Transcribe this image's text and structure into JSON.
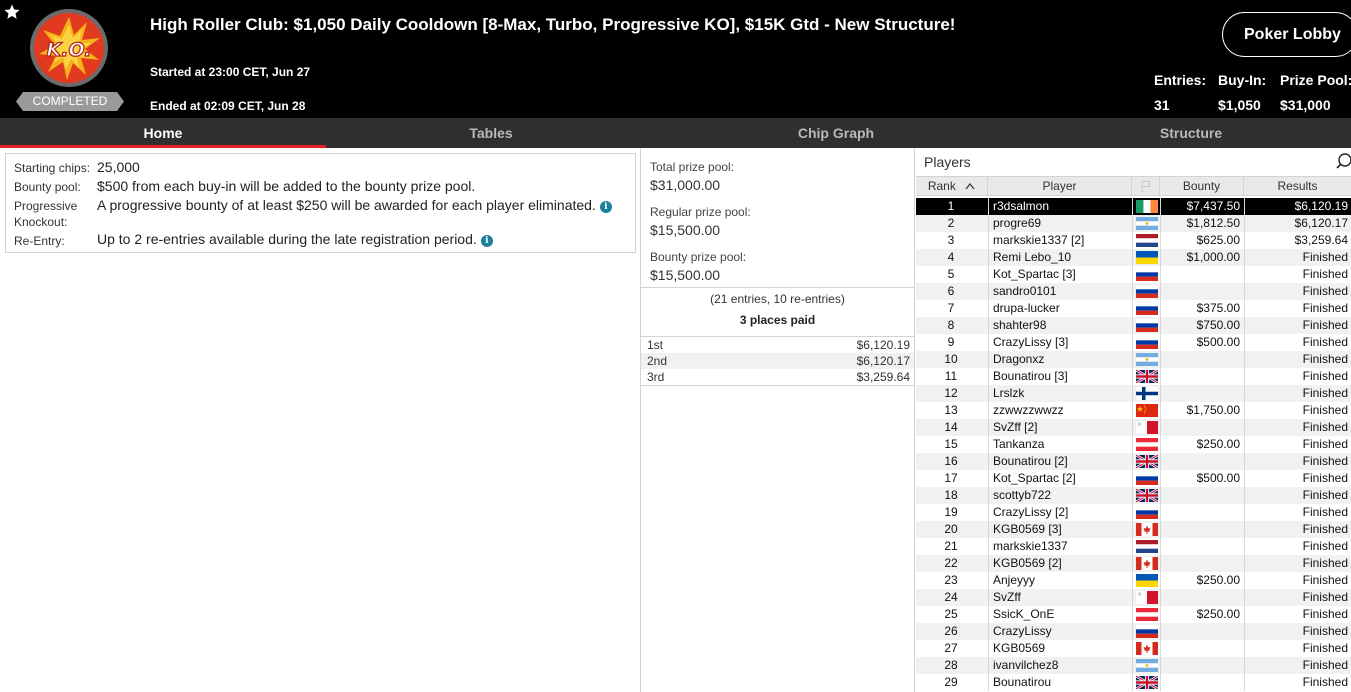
{
  "header": {
    "title": "High Roller Club: $1,050 Daily Cooldown [8-Max, Turbo, Progressive KO], $15K Gtd - New Structure!",
    "logo_text": "K.O.",
    "status_badge": "COMPLETED",
    "started": "Started at 23:00 CET, Jun 27",
    "ended": "Ended at 02:09 CET, Jun 28",
    "lobby_button": "Poker Lobby",
    "stats": {
      "entries_label": "Entries:",
      "entries_value": "31",
      "buyin_label": "Buy-In:",
      "buyin_value": "$1,050",
      "prizepool_label": "Prize Pool:",
      "prizepool_value": "$31,000"
    }
  },
  "tabs": [
    {
      "label": "Home",
      "active": true
    },
    {
      "label": "Tables",
      "active": false
    },
    {
      "label": "Chip Graph",
      "active": false
    },
    {
      "label": "Structure",
      "active": false
    }
  ],
  "info": {
    "starting_chips_label": "Starting chips:",
    "starting_chips_value": "25,000",
    "bounty_pool_label": "Bounty pool:",
    "bounty_pool_value": "$500 from each buy-in will be added to the bounty prize pool.",
    "pko_label_1": "Progressive",
    "pko_label_2": "Knockout:",
    "pko_value": "A progressive bounty of at least $250 will be awarded for each player eliminated.",
    "reentry_label": "Re-Entry:",
    "reentry_value": "Up to 2 re-entries available during the late registration period.",
    "info_glyph": "i"
  },
  "prize_pool": {
    "total_label": "Total prize pool:",
    "total_value": "$31,000.00",
    "regular_label": "Regular prize pool:",
    "regular_value": "$15,500.00",
    "bounty_label": "Bounty prize pool:",
    "bounty_value": "$15,500.00",
    "entries_note": "(21 entries, 10 re-entries)",
    "places_paid": "3 places paid",
    "payouts": [
      {
        "place": "1st",
        "amount": "$6,120.19"
      },
      {
        "place": "2nd",
        "amount": "$6,120.17"
      },
      {
        "place": "3rd",
        "amount": "$3,259.64"
      }
    ]
  },
  "players": {
    "title": "Players",
    "columns": {
      "rank": "Rank",
      "player": "Player",
      "bounty": "Bounty",
      "results": "Results"
    },
    "sort_indicator": "^",
    "selected_rank": 1,
    "rows": [
      {
        "rank": "1",
        "player": "r3dsalmon",
        "flag": "ie",
        "bounty": "$7,437.50",
        "result": "$6,120.19"
      },
      {
        "rank": "2",
        "player": "progre69",
        "flag": "ar",
        "bounty": "$1,812.50",
        "result": "$6,120.17"
      },
      {
        "rank": "3",
        "player": "markskie1337 [2]",
        "flag": "nl",
        "bounty": "$625.00",
        "result": "$3,259.64"
      },
      {
        "rank": "4",
        "player": "Remi Lebo_10",
        "flag": "ua",
        "bounty": "$1,000.00",
        "result": "Finished"
      },
      {
        "rank": "5",
        "player": "Kot_Spartac [3]",
        "flag": "ru",
        "bounty": "",
        "result": "Finished"
      },
      {
        "rank": "6",
        "player": "sandro0101",
        "flag": "ru",
        "bounty": "",
        "result": "Finished"
      },
      {
        "rank": "7",
        "player": "drupa-lucker",
        "flag": "ru",
        "bounty": "$375.00",
        "result": "Finished"
      },
      {
        "rank": "8",
        "player": "shahter98",
        "flag": "ru",
        "bounty": "$750.00",
        "result": "Finished"
      },
      {
        "rank": "9",
        "player": "CrazyLissy [3]",
        "flag": "ru",
        "bounty": "$500.00",
        "result": "Finished"
      },
      {
        "rank": "10",
        "player": "Dragonxz",
        "flag": "ar",
        "bounty": "",
        "result": "Finished"
      },
      {
        "rank": "11",
        "player": "Bounatirou [3]",
        "flag": "gb",
        "bounty": "",
        "result": "Finished"
      },
      {
        "rank": "12",
        "player": "Lrslzk",
        "flag": "fi",
        "bounty": "",
        "result": "Finished"
      },
      {
        "rank": "13",
        "player": "zzwwzzwwzz",
        "flag": "cn",
        "bounty": "$1,750.00",
        "result": "Finished"
      },
      {
        "rank": "14",
        "player": "SvZff [2]",
        "flag": "mt",
        "bounty": "",
        "result": "Finished"
      },
      {
        "rank": "15",
        "player": "Tankanza",
        "flag": "at",
        "bounty": "$250.00",
        "result": "Finished"
      },
      {
        "rank": "16",
        "player": "Bounatirou [2]",
        "flag": "gb",
        "bounty": "",
        "result": "Finished"
      },
      {
        "rank": "17",
        "player": "Kot_Spartac [2]",
        "flag": "ru",
        "bounty": "$500.00",
        "result": "Finished"
      },
      {
        "rank": "18",
        "player": "scottyb722",
        "flag": "gb",
        "bounty": "",
        "result": "Finished"
      },
      {
        "rank": "19",
        "player": "CrazyLissy [2]",
        "flag": "ru",
        "bounty": "",
        "result": "Finished"
      },
      {
        "rank": "20",
        "player": "KGB0569 [3]",
        "flag": "ca",
        "bounty": "",
        "result": "Finished"
      },
      {
        "rank": "21",
        "player": "markskie1337",
        "flag": "nl",
        "bounty": "",
        "result": "Finished"
      },
      {
        "rank": "22",
        "player": "KGB0569 [2]",
        "flag": "ca",
        "bounty": "",
        "result": "Finished"
      },
      {
        "rank": "23",
        "player": "Anjeyyy",
        "flag": "ua",
        "bounty": "$250.00",
        "result": "Finished"
      },
      {
        "rank": "24",
        "player": "SvZff",
        "flag": "mt",
        "bounty": "",
        "result": "Finished"
      },
      {
        "rank": "25",
        "player": "SsicK_OnE",
        "flag": "at",
        "bounty": "$250.00",
        "result": "Finished"
      },
      {
        "rank": "26",
        "player": "CrazyLissy",
        "flag": "ru",
        "bounty": "",
        "result": "Finished"
      },
      {
        "rank": "27",
        "player": "KGB0569",
        "flag": "ca",
        "bounty": "",
        "result": "Finished"
      },
      {
        "rank": "28",
        "player": "ivanvilchez8",
        "flag": "ar",
        "bounty": "",
        "result": "Finished"
      },
      {
        "rank": "29",
        "player": "Bounatirou",
        "flag": "gb",
        "bounty": "",
        "result": "Finished"
      }
    ]
  },
  "colors": {
    "header_bg": "#000000",
    "tabbar_bg": "#2f2f2f",
    "active_tab_underline": "#e31e25",
    "badge_bg": "#9a9a9a",
    "info_icon": "#1b7f9e",
    "selected_row_bg": "#000000"
  },
  "icons": {
    "star": "star-icon",
    "search": "search-icon",
    "sort": "sort-up-icon",
    "flag_column": "flag-icon",
    "info": "info-icon"
  }
}
